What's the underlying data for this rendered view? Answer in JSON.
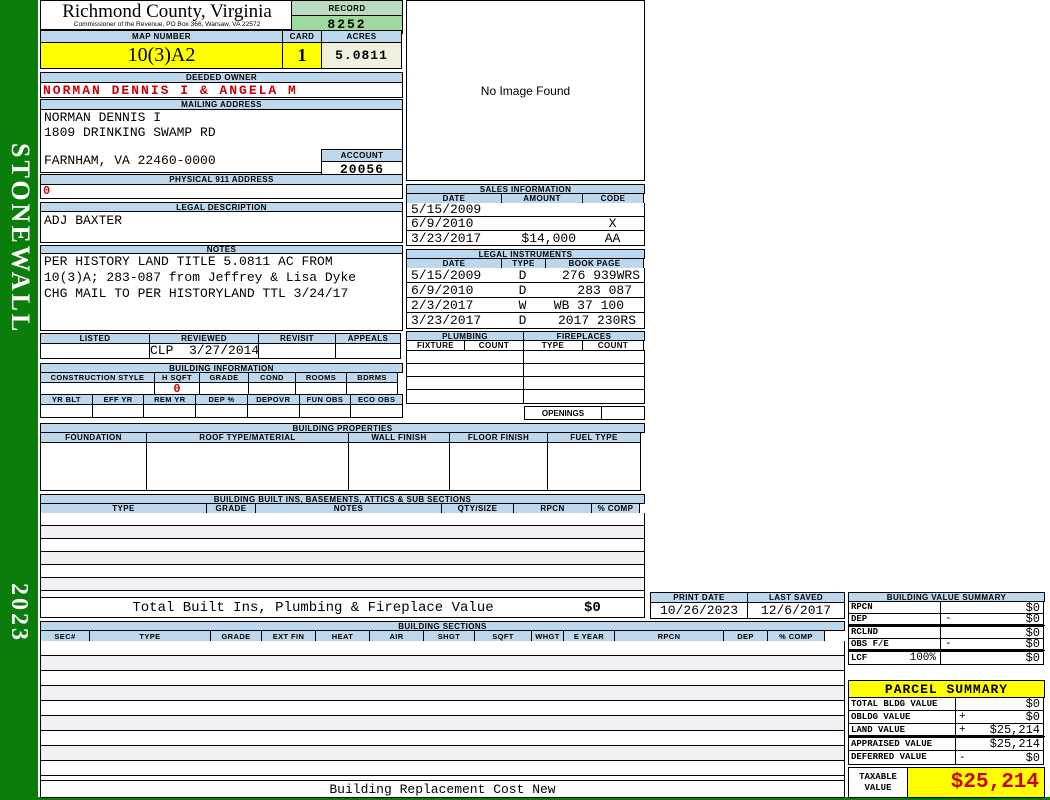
{
  "sidebar": {
    "district": "STONEWALL",
    "year": "2023"
  },
  "header": {
    "county": "Richmond County, Virginia",
    "office": "Commissioner of the Revenue, PO Box 366, Warsaw, VA 22572",
    "record_label": "RECORD",
    "record": "8252",
    "map_number_label": "MAP NUMBER",
    "map_number": "10(3)A2",
    "card_label": "CARD",
    "card": "1",
    "acres_label": "ACRES",
    "acres": "5.0811"
  },
  "owner": {
    "deeded_owner_label": "DEEDED OWNER",
    "deeded_owner": "NORMAN DENNIS I & ANGELA M",
    "mailing_address_label": "MAILING ADDRESS",
    "mailing_line1": "NORMAN DENNIS I",
    "mailing_line2": "1809 DRINKING SWAMP RD",
    "mailing_line3": "FARNHAM, VA 22460-0000",
    "account_label": "ACCOUNT",
    "account": "20056",
    "physical_label": "PHYSICAL 911 ADDRESS",
    "physical": "0"
  },
  "legal": {
    "label": "LEGAL DESCRIPTION",
    "value": "ADJ BAXTER"
  },
  "notes": {
    "label": "NOTES",
    "line1": "PER HISTORY LAND TITLE 5.0811 AC FROM",
    "line2": "10(3)A; 283-087 from Jeffrey & Lisa Dyke",
    "line3": "CHG MAIL TO PER HISTORYLAND TTL 3/24/17"
  },
  "review": {
    "headers": [
      "LISTED",
      "REVIEWED",
      "REVISIT",
      "APPEALS"
    ],
    "reviewed_value": "CLP  3/27/2014"
  },
  "building_information": {
    "label": "BUILDING INFORMATION",
    "row1_headers": [
      "CONSTRUCTION STYLE",
      "H SQFT",
      "GRADE",
      "COND",
      "ROOMS",
      "BDRMS"
    ],
    "h_sqft_value": "0",
    "row2_headers": [
      "YR BLT",
      "EFF YR",
      "REM YR",
      "DEP %",
      "DEPOVR",
      "FUN OBS",
      "ECO OBS"
    ]
  },
  "building_properties": {
    "label": "BUILDING PROPERTIES",
    "headers": [
      "FOUNDATION",
      "ROOF TYPE/MATERIAL",
      "WALL FINISH",
      "FLOOR FINISH",
      "FUEL TYPE"
    ]
  },
  "built_ins": {
    "label": "BUILDING BUILT INS, BASEMENTS, ATTICS & SUB SECTIONS",
    "headers": [
      "TYPE",
      "GRADE",
      "NOTES",
      "QTY/SIZE",
      "RPCN",
      "% COMP"
    ],
    "total_label": "Total Built Ins, Plumbing & Fireplace Value",
    "total_value": "$0"
  },
  "building_sections": {
    "label": "BUILDING SECTIONS",
    "headers": [
      "SEC#",
      "TYPE",
      "GRADE",
      "EXT FIN",
      "HEAT",
      "AIR",
      "SHGT",
      "SQFT",
      "WHGT",
      "E YEAR",
      "RPCN",
      "DEP",
      "% COMP"
    ],
    "footer": "Building Replacement Cost New"
  },
  "image_box": {
    "message": "No Image Found"
  },
  "sales": {
    "label": "SALES INFORMATION",
    "headers": [
      "DATE",
      "AMOUNT",
      "CODE"
    ],
    "rows": [
      [
        "5/15/2009",
        "",
        ""
      ],
      [
        "6/9/2010",
        "",
        "X"
      ],
      [
        "3/23/2017",
        "$14,000",
        "AA"
      ]
    ]
  },
  "legal_instruments": {
    "label": "LEGAL INSTRUMENTS",
    "headers": [
      "DATE",
      "TYPE",
      "BOOK PAGE"
    ],
    "rows": [
      [
        "5/15/2009",
        "D",
        "276 939WRS"
      ],
      [
        "6/9/2010",
        "D",
        "283 087"
      ],
      [
        "2/3/2017",
        "W",
        "WB 37 100"
      ],
      [
        "3/23/2017",
        "D",
        "2017 230RS"
      ]
    ]
  },
  "plumbing": {
    "label": "PLUMBING",
    "headers": [
      "FIXTURE",
      "COUNT"
    ]
  },
  "fireplaces": {
    "label": "FIREPLACES",
    "headers": [
      "TYPE",
      "COUNT"
    ],
    "openings_label": "OPENINGS"
  },
  "print_info": {
    "print_date_label": "PRINT DATE",
    "print_date": "10/26/2023",
    "last_saved_label": "LAST SAVED",
    "last_saved": "12/6/2017"
  },
  "building_value_summary": {
    "label": "BUILDING VALUE SUMMARY",
    "rows": [
      {
        "label": "RPCN",
        "op": "",
        "value": "$0"
      },
      {
        "label": "DEP",
        "op": "-",
        "value": "$0"
      },
      {
        "label": "RCLND",
        "op": "",
        "value": "$0"
      },
      {
        "label": "OBS F/E",
        "op": "-",
        "value": "$0"
      },
      {
        "label": "LCF",
        "pct": "100%",
        "op": "",
        "value": "$0"
      }
    ]
  },
  "parcel_summary": {
    "label": "PARCEL SUMMARY",
    "rows": [
      {
        "label": "TOTAL BLDG VALUE",
        "op": "",
        "value": "$0"
      },
      {
        "label": "OBLDG VALUE",
        "op": "+",
        "value": "$0"
      },
      {
        "label": "LAND VALUE",
        "op": "+",
        "value": "$25,214"
      },
      {
        "label": "APPRAISED VALUE",
        "op": "",
        "value": "$25,214"
      },
      {
        "label": "DEFERRED VALUE",
        "op": "-",
        "value": "$0"
      }
    ],
    "taxable_label": "TAXABLE VALUE",
    "taxable_value": "$25,214"
  },
  "colors": {
    "green": "#0a7d0a",
    "header_blue": "#bdd7ec",
    "record_green": "#9ed99e",
    "yellow": "#ffff00",
    "cream": "#f1f0df",
    "red": "#cc0000"
  }
}
